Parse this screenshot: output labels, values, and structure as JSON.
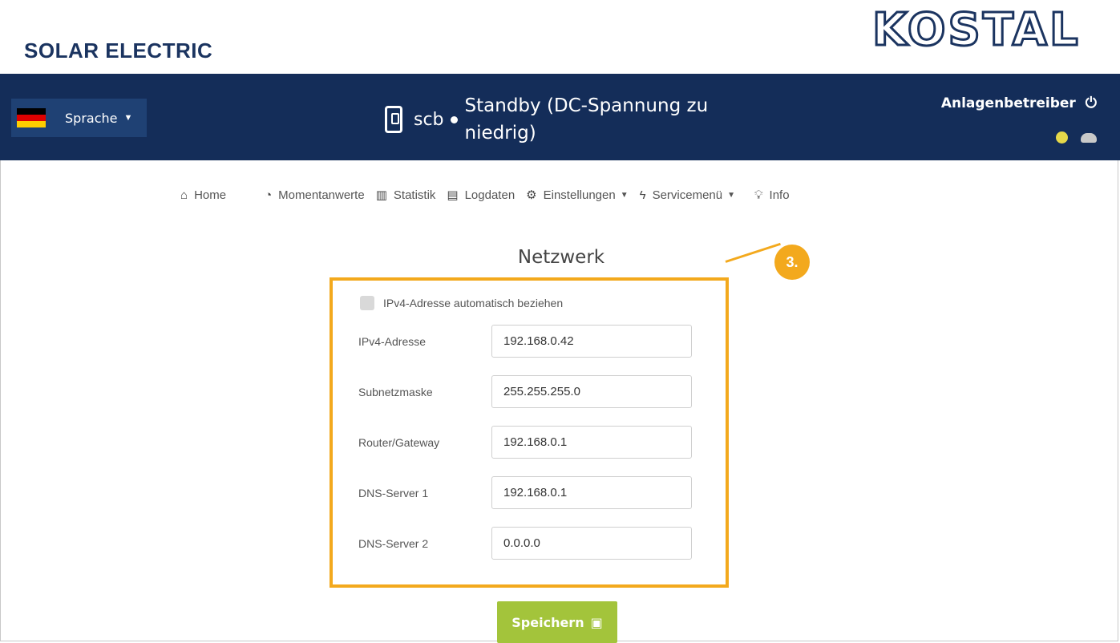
{
  "brand": {
    "title": "SOLAR ELECTRIC",
    "logo": "KOSTAL"
  },
  "header": {
    "language_label": "Sprache",
    "device_name": "scb",
    "status": "Standby (DC-Spannung zu niedrig)",
    "user": "Anlagenbetreiber",
    "icons": [
      "globe-icon",
      "cloud-upload-icon"
    ]
  },
  "nav": {
    "items": [
      {
        "label": "Home",
        "icon": "home-icon"
      },
      {
        "label": "Momentanwerte",
        "icon": "dashboard-icon"
      },
      {
        "label": "Statistik",
        "icon": "bar-chart-icon"
      },
      {
        "label": "Logdaten",
        "icon": "document-icon"
      },
      {
        "label": "Einstellungen",
        "icon": "gear-icon"
      },
      {
        "label": "Servicemenü",
        "icon": "bolt-icon"
      },
      {
        "label": "Info",
        "icon": "lightbulb-icon"
      }
    ]
  },
  "form": {
    "title": "Netzwerk",
    "auto_ipv4_label": "IPv4-Adresse automatisch beziehen",
    "fields": [
      {
        "label": "IPv4-Adresse",
        "value": "192.168.0.42"
      },
      {
        "label": "Subnetzmaske",
        "value": "255.255.255.0"
      },
      {
        "label": "Router/Gateway",
        "value": "192.168.0.1"
      },
      {
        "label": "DNS-Server 1",
        "value": "192.168.0.1"
      },
      {
        "label": "DNS-Server 2",
        "value": "0.0.0.0"
      }
    ],
    "save_label": "Speichern"
  },
  "annotation": {
    "badge": "3."
  },
  "colors": {
    "header_bg": "#142d59",
    "brand_text": "#1b3460",
    "highlight": "#f3a91d",
    "save_button": "#a3c43b"
  }
}
